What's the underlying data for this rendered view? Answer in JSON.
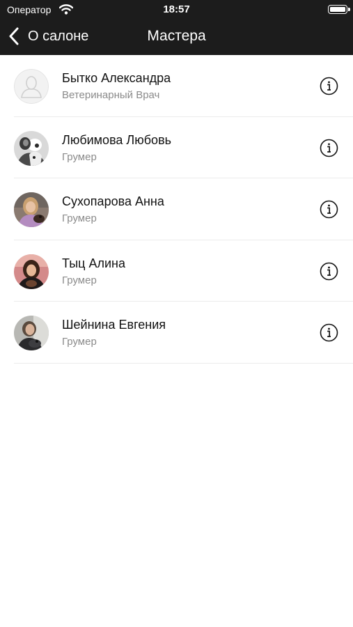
{
  "status_bar": {
    "carrier": "Оператор",
    "time": "18:57"
  },
  "nav": {
    "back_label": "О салоне",
    "title": "Мастера"
  },
  "masters": [
    {
      "name": "Бытко Александра",
      "role": "Ветеринарный Врач",
      "avatar": "placeholder-person-icon"
    },
    {
      "name": "Любимова Любовь",
      "role": "Грумер",
      "avatar": "photo"
    },
    {
      "name": "Сухопарова Анна",
      "role": "Грумер",
      "avatar": "photo"
    },
    {
      "name": "Тыц Алина",
      "role": "Грумер",
      "avatar": "photo"
    },
    {
      "name": "Шейнина Евгения",
      "role": "Грумер",
      "avatar": "photo"
    }
  ],
  "icons": {
    "back": "chevron-left-icon",
    "info": "info-circle-icon",
    "wifi": "wifi-icon",
    "battery": "battery-icon"
  },
  "colors": {
    "header_background": "#1c1c1c",
    "header_text": "#ffffff",
    "primary_text": "#111111",
    "secondary_text": "#8a8a8a",
    "divider": "#ebebeb"
  }
}
